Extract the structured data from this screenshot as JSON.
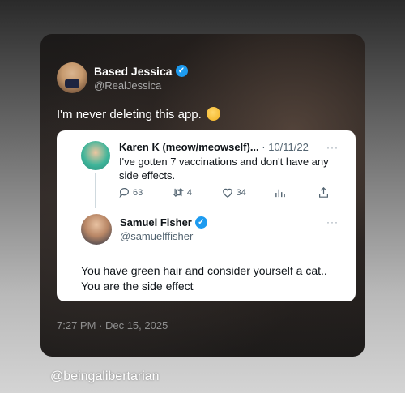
{
  "post": {
    "author_name": "Based Jessica",
    "author_handle": "@RealJessica",
    "text": "I'm never deleting this app.",
    "emoji": "rolling-on-floor-laughing-emoji",
    "timestamp": "7:27 PM · Dec 15, 2025"
  },
  "quoted": {
    "original": {
      "name": "Karen K (meow/meowself)...",
      "date": "· 10/11/22",
      "text": "I've gotten 7 vaccinations and don't have any side effects.",
      "actions": {
        "replies": "63",
        "retweets": "4",
        "likes": "34"
      }
    },
    "reply": {
      "name": "Samuel Fisher",
      "handle": "@samuelffisher",
      "text": "You have green hair and consider yourself a cat.. You are the side effect"
    }
  },
  "watermark": "@beingalibertarian",
  "colors": {
    "verified": "#1d9bf0",
    "card_bg": "#1f1c1b",
    "quote_bg": "#ffffff"
  }
}
